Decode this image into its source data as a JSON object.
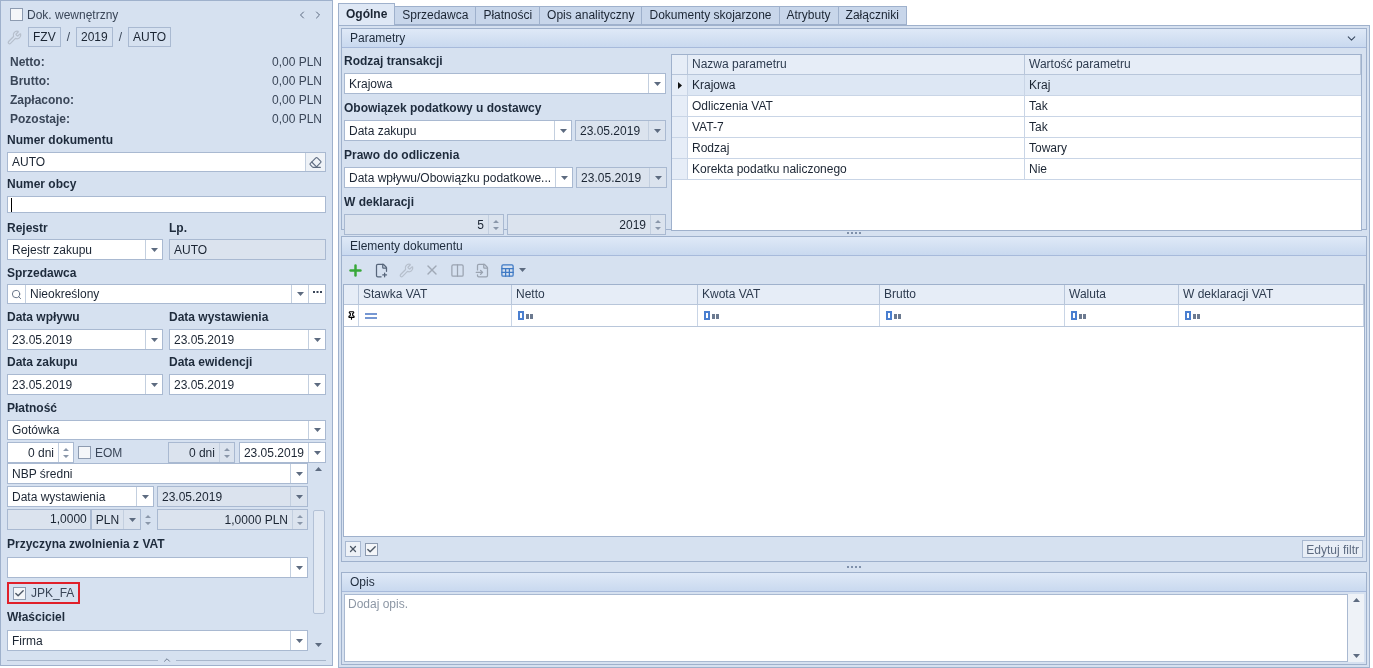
{
  "left": {
    "internal_doc": {
      "label": "Dok. wewnętrzny",
      "checked": false
    },
    "series": [
      {
        "value": "FZV"
      },
      {
        "separator": "/",
        "value": "2019"
      },
      {
        "separator": "/",
        "value": "AUTO"
      }
    ],
    "totals": [
      {
        "label": "Netto:",
        "value": "0,00 PLN"
      },
      {
        "label": "Brutto:",
        "value": "0,00 PLN"
      },
      {
        "label": "Zapłacono:",
        "value": "0,00 PLN"
      },
      {
        "label": "Pozostaje:",
        "value": "0,00 PLN"
      }
    ],
    "doc_number": {
      "label": "Numer dokumentu",
      "value": "AUTO"
    },
    "foreign_number": {
      "label": "Numer obcy"
    },
    "register": {
      "label": "Rejestr",
      "value": "Rejestr zakupu"
    },
    "lp": {
      "label": "Lp.",
      "value": "AUTO"
    },
    "seller": {
      "label": "Sprzedawca",
      "value": "Nieokreślony"
    },
    "dates": [
      {
        "label": "Data wpływu",
        "value": "23.05.2019"
      },
      {
        "label": "Data wystawienia",
        "value": "23.05.2019"
      },
      {
        "label": "Data zakupu",
        "value": "23.05.2019"
      },
      {
        "label": "Data ewidencji",
        "value": "23.05.2019"
      }
    ],
    "payment": {
      "label": "Płatność",
      "value": "Gotówka"
    },
    "term": "0 dni",
    "eom": {
      "label": "EOM",
      "checked": false
    },
    "term_2": "0 dni",
    "due_date": "23.05.2019",
    "rate_type": "NBP średni",
    "rate_basis": "Data wystawienia",
    "rate_date": "23.05.2019",
    "rate": "1,0000",
    "currency": "PLN",
    "rate_2": "1,0000 PLN",
    "vat_exemption": {
      "label": "Przyczyna zwolnienia z VAT"
    },
    "jpk": {
      "label": "JPK_FA",
      "checked": true
    },
    "owner": {
      "label": "Właściciel",
      "value": "Firma"
    }
  },
  "tabs": [
    {
      "label": "Ogólne",
      "selected": true
    },
    {
      "label": "Sprzedawca",
      "selected": false
    },
    {
      "label": "Płatności",
      "selected": false
    },
    {
      "label": "Opis analityczny",
      "selected": false
    },
    {
      "label": "Dokumenty skojarzone",
      "selected": false
    },
    {
      "label": "Atrybuty",
      "selected": false
    },
    {
      "label": "Załączniki",
      "selected": false
    }
  ],
  "parameters": {
    "title": "Parametry",
    "transaction_type": {
      "label": "Rodzaj transakcji",
      "value": "Krajowa"
    },
    "tax_obligation": {
      "label": "Obowiązek podatkowy u dostawcy",
      "value": "Data zakupu",
      "date": "23.05.2019"
    },
    "deduction_right": {
      "label": "Prawo do odliczenia",
      "value": "Data wpływu/Obowiązku podatkowe...",
      "date": "23.05.2019"
    },
    "declaration": {
      "label": "W deklaracji",
      "month": "5",
      "year": "2019"
    },
    "table": {
      "columns": [
        "Nazwa parametru",
        "Wartość parametru"
      ],
      "rows": [
        {
          "name": "Krajowa",
          "value": "Kraj",
          "selected": true
        },
        {
          "name": "Odliczenia VAT",
          "value": "Tak",
          "selected": false
        },
        {
          "name": "VAT-7",
          "value": "Tak",
          "selected": false
        },
        {
          "name": "Rodzaj",
          "value": "Towary",
          "selected": false
        },
        {
          "name": "Korekta podatku naliczonego",
          "value": "Nie",
          "selected": false
        }
      ]
    }
  },
  "elements": {
    "title": "Elementy dokumentu",
    "columns": [
      {
        "label": "Stawka VAT",
        "kind": "equals"
      },
      {
        "label": "Netto",
        "kind": "text"
      },
      {
        "label": "Kwota VAT",
        "kind": "text"
      },
      {
        "label": "Brutto",
        "kind": "text"
      },
      {
        "label": "Waluta",
        "kind": "text"
      },
      {
        "label": "W deklaracji VAT",
        "kind": "text"
      }
    ],
    "filter_enabled": true,
    "edit_filter_button": "Edytuj filtr"
  },
  "description": {
    "title": "Opis",
    "placeholder": "Dodaj opis."
  }
}
